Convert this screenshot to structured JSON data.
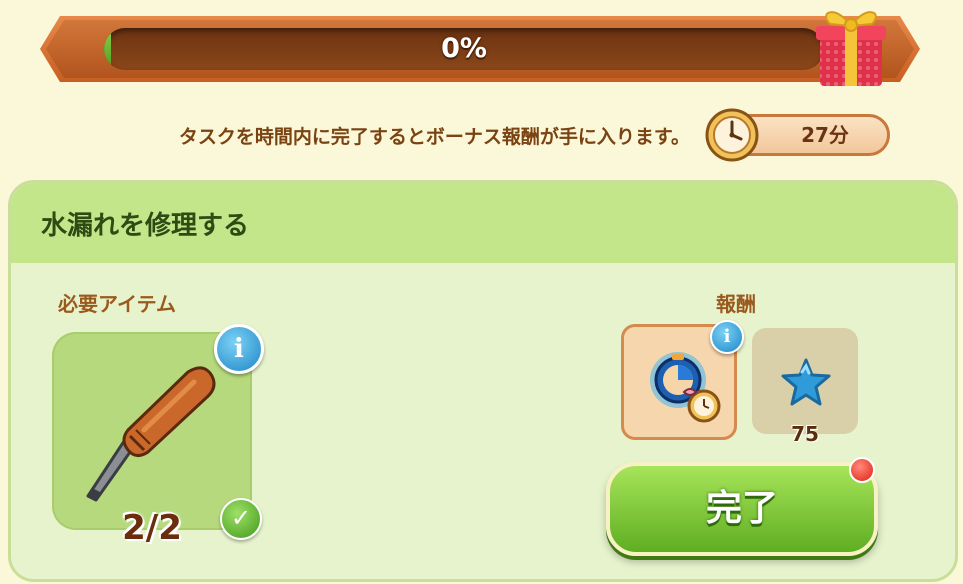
{
  "progress": {
    "label": "0%",
    "fraction": 0.0
  },
  "bonus": {
    "text": "タスクを時間内に完了するとボーナス報酬が手に入ります。",
    "timer_value": "27分"
  },
  "task": {
    "title": "水漏れを修理する",
    "required_label": "必要アイテム",
    "required_item": {
      "icon": "screwdriver-icon",
      "count": "2/2",
      "info": "i"
    },
    "reward_label": "報酬",
    "rewards": [
      {
        "icon": "time-boost-icon",
        "info": "i"
      },
      {
        "icon": "blue-star-icon",
        "count": "75"
      }
    ],
    "complete_label": "完了"
  },
  "colors": {
    "frame": "#c75f22",
    "panel_header": "#c3e68b",
    "button": "#5fae22",
    "notification": "#e11f12"
  }
}
